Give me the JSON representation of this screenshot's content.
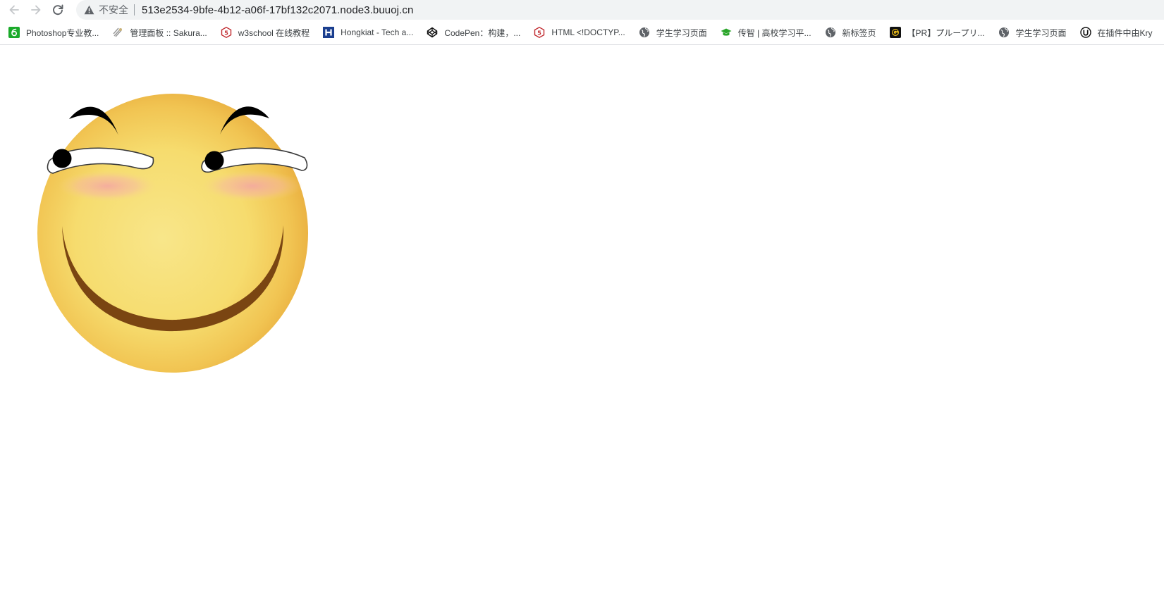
{
  "browser": {
    "insecure_label": "不安全",
    "url": "513e2534-9bfe-4b12-a06f-17bf132c2071.node3.buuoj.cn",
    "nav_icons": [
      "back-arrow-icon",
      "forward-arrow-icon",
      "reload-icon",
      "warning-icon"
    ]
  },
  "bookmarks": [
    {
      "label": "Photoshop专业教...",
      "icon": "photoshop-icon",
      "color": "#1aaa2a"
    },
    {
      "label": "管理面板 :: Sakura...",
      "icon": "sakura-icon",
      "color": "#8a8a8a"
    },
    {
      "label": "w3school 在线教程",
      "icon": "w3school-icon",
      "color": "#c0282d"
    },
    {
      "label": "Hongkiat - Tech a...",
      "icon": "hongkiat-icon",
      "color": "#1b3f8f"
    },
    {
      "label": "CodePen：构建，...",
      "icon": "codepen-icon",
      "color": "#111111"
    },
    {
      "label": "HTML <!DOCTYP...",
      "icon": "w3school-icon",
      "color": "#c0282d"
    },
    {
      "label": "学生学习页面",
      "icon": "globe-icon",
      "color": "#5f6368"
    },
    {
      "label": "传智 | 高校学习平...",
      "icon": "graduation-cap-icon",
      "color": "#2aa52a"
    },
    {
      "label": "新标签页",
      "icon": "globe-icon",
      "color": "#5f6368"
    },
    {
      "label": "【PR】プループリ...",
      "icon": "pr-icon",
      "color": "#111111"
    },
    {
      "label": "学生学习页面",
      "icon": "globe-icon",
      "color": "#5f6368"
    },
    {
      "label": "在插件中由Kry",
      "icon": "unreal-icon",
      "color": "#111111"
    }
  ],
  "colors": {
    "face_center": "#f8e47a",
    "face_edge": "#e9ae3c",
    "mouth": "#7a4512",
    "blush": "#f2a7a0",
    "eyebrow": "#000000",
    "pupil": "#000000"
  }
}
